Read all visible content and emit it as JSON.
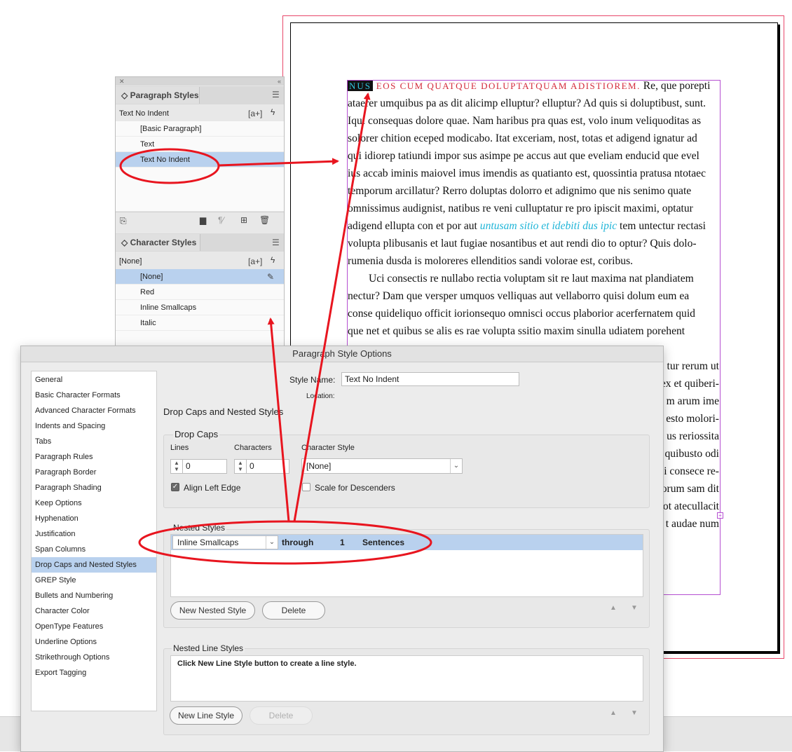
{
  "document": {
    "lines": [
      {
        "parts": [
          {
            "t": "NUS",
            "c": "dropcap-hl"
          },
          {
            "t": " EOS CUM QUATQUE DOLUPTATQUAM ADISTIOREM.",
            "c": "smallcaps"
          },
          {
            "t": "  Re, que porepti",
            "c": ""
          }
        ]
      },
      {
        "parts": [
          {
            "t": "ataerer umquibus pa as dit alicimp elluptur? elluptur? Ad quis si doluptibust, sunt.",
            "c": ""
          }
        ]
      },
      {
        "parts": [
          {
            "t": "Iqui consequas dolore quae. Nam haribus pra quas est, volo inum veliquoditas as",
            "c": ""
          }
        ]
      },
      {
        "parts": [
          {
            "t": "solorer chition eceped modicabo. Itat exceriam, nost, totas et adigend ignatur ad",
            "c": ""
          }
        ]
      },
      {
        "parts": [
          {
            "t": "qui idiorep tatiundi impor sus asimpe pe accus aut que eveliam enducid que evel",
            "c": ""
          }
        ]
      },
      {
        "parts": [
          {
            "t": "ius accab iminis maiovel imus imendis as quatianto est, quossintia pratusa ntotaec",
            "c": ""
          }
        ]
      },
      {
        "parts": [
          {
            "t": "temporum arcillatur? Rerro doluptas dolorro et adignimo que nis senimo quate",
            "c": ""
          }
        ]
      },
      {
        "parts": [
          {
            "t": "omnissimus audignist, natibus re veni culluptatur re pro ipiscit maximi, optatur",
            "c": ""
          }
        ]
      },
      {
        "parts": [
          {
            "t": "adigend ellupta con et por aut ",
            "c": ""
          },
          {
            "t": "untusam sitio et idebiti dus ipic",
            "c": "italic-cyan"
          },
          {
            "t": " tem untectur rectasi",
            "c": ""
          }
        ]
      },
      {
        "parts": [
          {
            "t": "volupta plibusanis et laut fugiae nosantibus et aut rendi dio to optur? Quis dolo-",
            "c": ""
          }
        ]
      },
      {
        "parts": [
          {
            "t": "rumenia dusda is moloreres ellenditios sandi volorae est, coribus.",
            "c": ""
          }
        ]
      },
      {
        "parts": [
          {
            "t": "Uci consectis re nullabo rectia voluptam sit re laut maxima nat plandiatem",
            "c": "indent"
          }
        ]
      },
      {
        "parts": [
          {
            "t": "nectur? Dam que versper umquos velliquas aut vellaborro quisi dolum eum ea",
            "c": ""
          }
        ]
      },
      {
        "parts": [
          {
            "t": "conse quideliquo officit iorionsequo omnisci occus plaborior acerfernatem quid",
            "c": ""
          }
        ]
      },
      {
        "parts": [
          {
            "t": "que net et quibus se alis es rae volupta ssitio maxim sinulla udiatem porehent",
            "c": ""
          }
        ]
      },
      {
        "parts": [
          {
            "t": "",
            "c": ""
          }
        ]
      },
      {
        "parts": [
          {
            "t": "tur rerum ut",
            "c": ""
          }
        ]
      },
      {
        "parts": [
          {
            "t": "ex et quiberi-",
            "c": ""
          }
        ]
      },
      {
        "parts": [
          {
            "t": "m arum ime",
            "c": ""
          }
        ]
      },
      {
        "parts": [
          {
            "t": "esto molori-",
            "c": ""
          }
        ]
      },
      {
        "parts": [
          {
            "t": "us reriossita",
            "c": ""
          }
        ]
      },
      {
        "parts": [
          {
            "t": "quibusto odi",
            "c": ""
          }
        ]
      },
      {
        "parts": [
          {
            "t": "i consece re-",
            "c": ""
          }
        ]
      },
      {
        "parts": [
          {
            "t": "orum sam dit",
            "c": ""
          }
        ]
      },
      {
        "parts": [
          {
            "t": "ot atecullacit",
            "c": ""
          }
        ]
      },
      {
        "parts": [
          {
            "t": "t audae num",
            "c": ""
          }
        ]
      }
    ]
  },
  "paragraph_styles": {
    "tab": "Paragraph Styles",
    "current": "Text No Indent",
    "items": [
      {
        "label": "[Basic Paragraph]",
        "selected": false
      },
      {
        "label": "Text",
        "selected": false
      },
      {
        "label": "Text No Indent",
        "selected": true
      }
    ]
  },
  "character_styles": {
    "tab": "Character Styles",
    "current": "[None]",
    "items": [
      {
        "label": "[None]",
        "selected": true
      },
      {
        "label": "Red",
        "selected": false
      },
      {
        "label": "Inline Smallcaps",
        "selected": false
      },
      {
        "label": "Italic",
        "selected": false
      }
    ]
  },
  "dialog": {
    "title": "Paragraph Style Options",
    "categories": [
      {
        "label": "General",
        "selected": false
      },
      {
        "label": "Basic Character Formats",
        "selected": false
      },
      {
        "label": "Advanced Character Formats",
        "selected": false
      },
      {
        "label": "Indents and Spacing",
        "selected": false
      },
      {
        "label": "Tabs",
        "selected": false
      },
      {
        "label": "Paragraph Rules",
        "selected": false
      },
      {
        "label": "Paragraph Border",
        "selected": false
      },
      {
        "label": "Paragraph Shading",
        "selected": false
      },
      {
        "label": "Keep Options",
        "selected": false
      },
      {
        "label": "Hyphenation",
        "selected": false
      },
      {
        "label": "Justification",
        "selected": false
      },
      {
        "label": "Span Columns",
        "selected": false
      },
      {
        "label": "Drop Caps and Nested Styles",
        "selected": true
      },
      {
        "label": "GREP Style",
        "selected": false
      },
      {
        "label": "Bullets and Numbering",
        "selected": false
      },
      {
        "label": "Character Color",
        "selected": false
      },
      {
        "label": "OpenType Features",
        "selected": false
      },
      {
        "label": "Underline Options",
        "selected": false
      },
      {
        "label": "Strikethrough Options",
        "selected": false
      },
      {
        "label": "Export Tagging",
        "selected": false
      }
    ],
    "style_name_label": "Style Name:",
    "style_name_value": "Text No Indent",
    "location_label": "Location:",
    "section_title": "Drop Caps and Nested Styles",
    "drop_caps": {
      "title": "Drop Caps",
      "lines_label": "Lines",
      "lines_value": "0",
      "characters_label": "Characters",
      "characters_value": "0",
      "char_style_label": "Character Style",
      "char_style_value": "[None]",
      "align_left_edge_label": "Align Left Edge",
      "align_left_edge_checked": true,
      "scale_descenders_label": "Scale for Descenders",
      "scale_descenders_checked": false
    },
    "nested_styles": {
      "title": "Nested Styles",
      "row": {
        "style": "Inline Smallcaps",
        "mode": "through",
        "count": "1",
        "unit": "Sentences"
      },
      "new_button": "New Nested Style",
      "delete_button": "Delete"
    },
    "nested_line_styles": {
      "title": "Nested Line Styles",
      "hint": "Click New Line Style button to create a line style.",
      "new_button": "New Line Style",
      "delete_button": "Delete"
    }
  },
  "colors": {
    "annotation": "#e8151f",
    "selection": "#b9d1ee",
    "frame": "#b54fd1",
    "bleed": "#e8476a"
  }
}
